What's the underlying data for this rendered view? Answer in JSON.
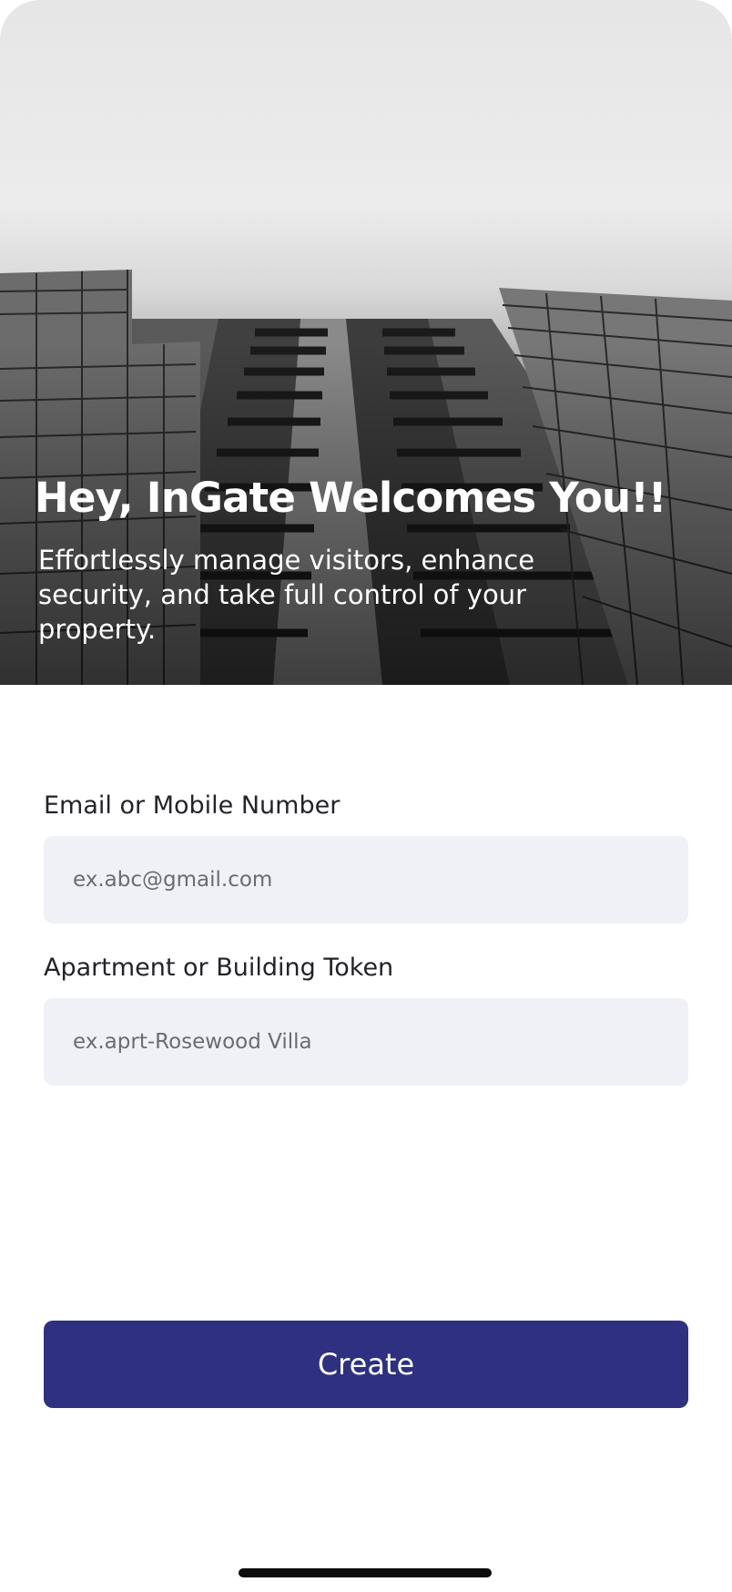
{
  "hero": {
    "title": "Hey, InGate Welcomes You!!",
    "subtitle": "Effortlessly manage visitors, enhance security, and take full control of your property."
  },
  "form": {
    "email": {
      "label": "Email or Mobile Number",
      "placeholder": "ex.abc@gmail.com",
      "value": ""
    },
    "token": {
      "label": "Apartment or Building Token",
      "placeholder": "ex.aprt-Rosewood Villa",
      "value": ""
    },
    "submit_label": "Create"
  },
  "colors": {
    "primary": "#2f3080",
    "input_background": "#f0f1f6",
    "text": "#23232b",
    "placeholder": "#6b6b72"
  }
}
